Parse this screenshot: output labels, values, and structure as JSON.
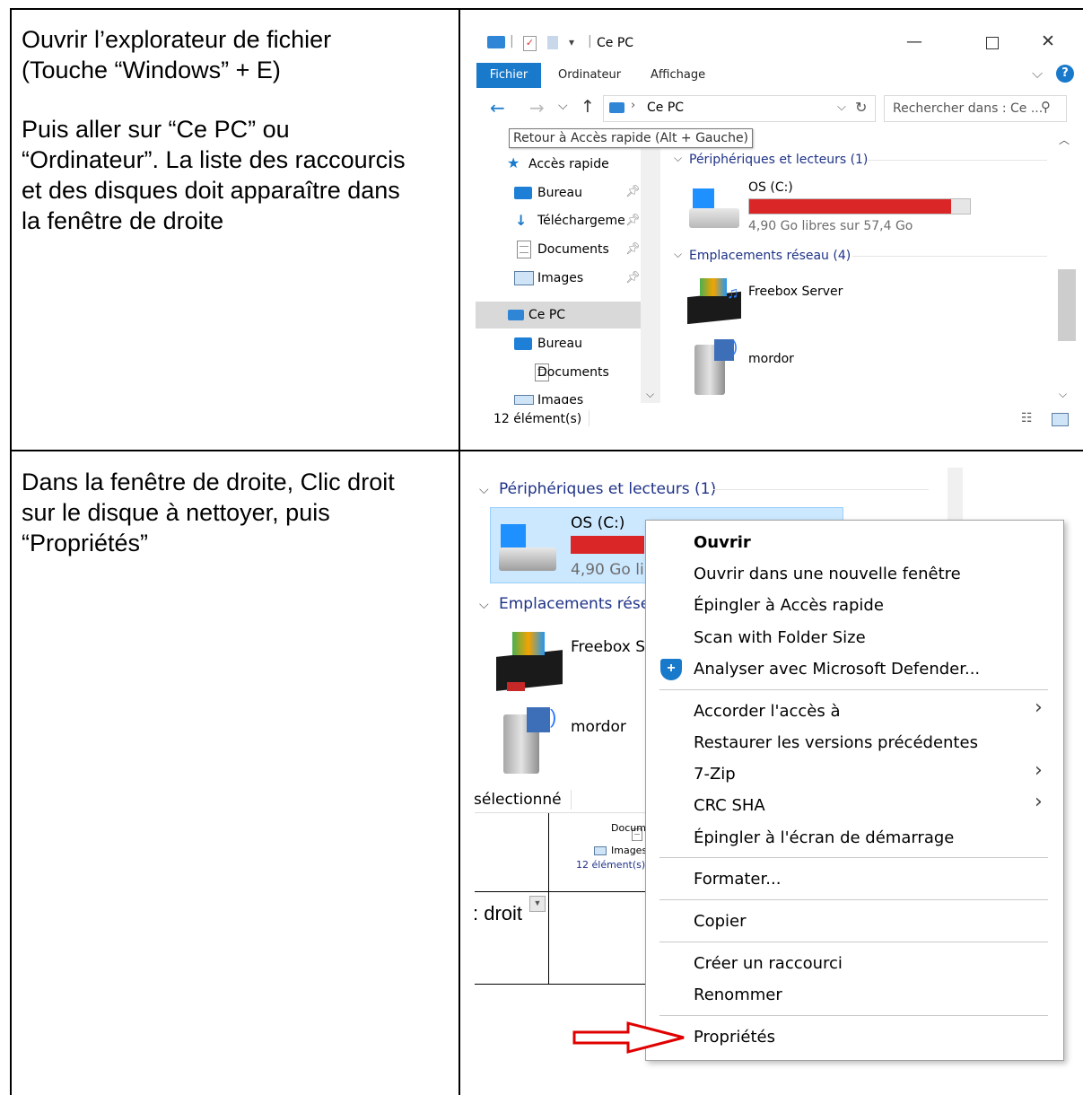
{
  "instructions": {
    "step1_line1": "Ouvrir l’explorateur de fichier\n(Touche “Windows” + E)",
    "step1_line2": "Puis aller sur “Ce PC” ou\n“Ordinateur”. La liste des raccourcis\net des disques doit apparaître dans\nla fenêtre de droite",
    "step2": "Dans la fenêtre de droite, Clic droit\nsur le disque à nettoyer, puis\n“Propriétés”"
  },
  "explorer": {
    "title": "Ce PC",
    "ribbon_tabs": [
      "Fichier",
      "Ordinateur",
      "Affichage"
    ],
    "address": "Ce PC",
    "search_placeholder": "Rechercher dans : Ce ...",
    "tooltip": "Retour à Accès rapide (Alt + Gauche)",
    "nav_items": [
      "Accès rapide",
      "Bureau",
      "Téléchargeme",
      "Documents",
      "Images",
      "Ce PC",
      "Bureau",
      "Documents",
      "Images"
    ],
    "group_devices": "Périphériques et lecteurs (1)",
    "drive_name": "OS (C:)",
    "drive_free": "4,90 Go libres sur 57,4 Go",
    "drive_used_fraction": 0.915,
    "group_network": "Emplacements réseau (4)",
    "network_items": [
      "Freebox Server",
      "mordor"
    ],
    "status": "12 élément(s)"
  },
  "second": {
    "group_devices": "Périphériques et lecteurs (1)",
    "drive_name": "OS (C:)",
    "drive_free_partial": "4,90 Go lib",
    "group_network_partial": "Emplacements rése",
    "freebox_partial": "Freebox S",
    "mordor": "mordor",
    "selected_partial": "sélectionné",
    "docum_partial": "Docum",
    "images_partial": "Images",
    "status_small": "12 élément(s)",
    "droit_partial": ": droit"
  },
  "context_menu": {
    "open": "Ouvrir",
    "items": [
      "Ouvrir dans une nouvelle fenêtre",
      "Épingler à Accès rapide",
      "Scan with Folder Size",
      "Analyser avec Microsoft Defender...",
      "Accorder l'accès à",
      "Restaurer les versions précédentes",
      "7-Zip",
      "CRC SHA",
      "Épingler à l'écran de démarrage",
      "Formater...",
      "Copier",
      "Créer un raccourci",
      "Renommer",
      "Propriétés"
    ]
  },
  "colors": {
    "accent": "#0067c0",
    "drive_bar": "#da2626",
    "selection": "#cce8ff"
  }
}
